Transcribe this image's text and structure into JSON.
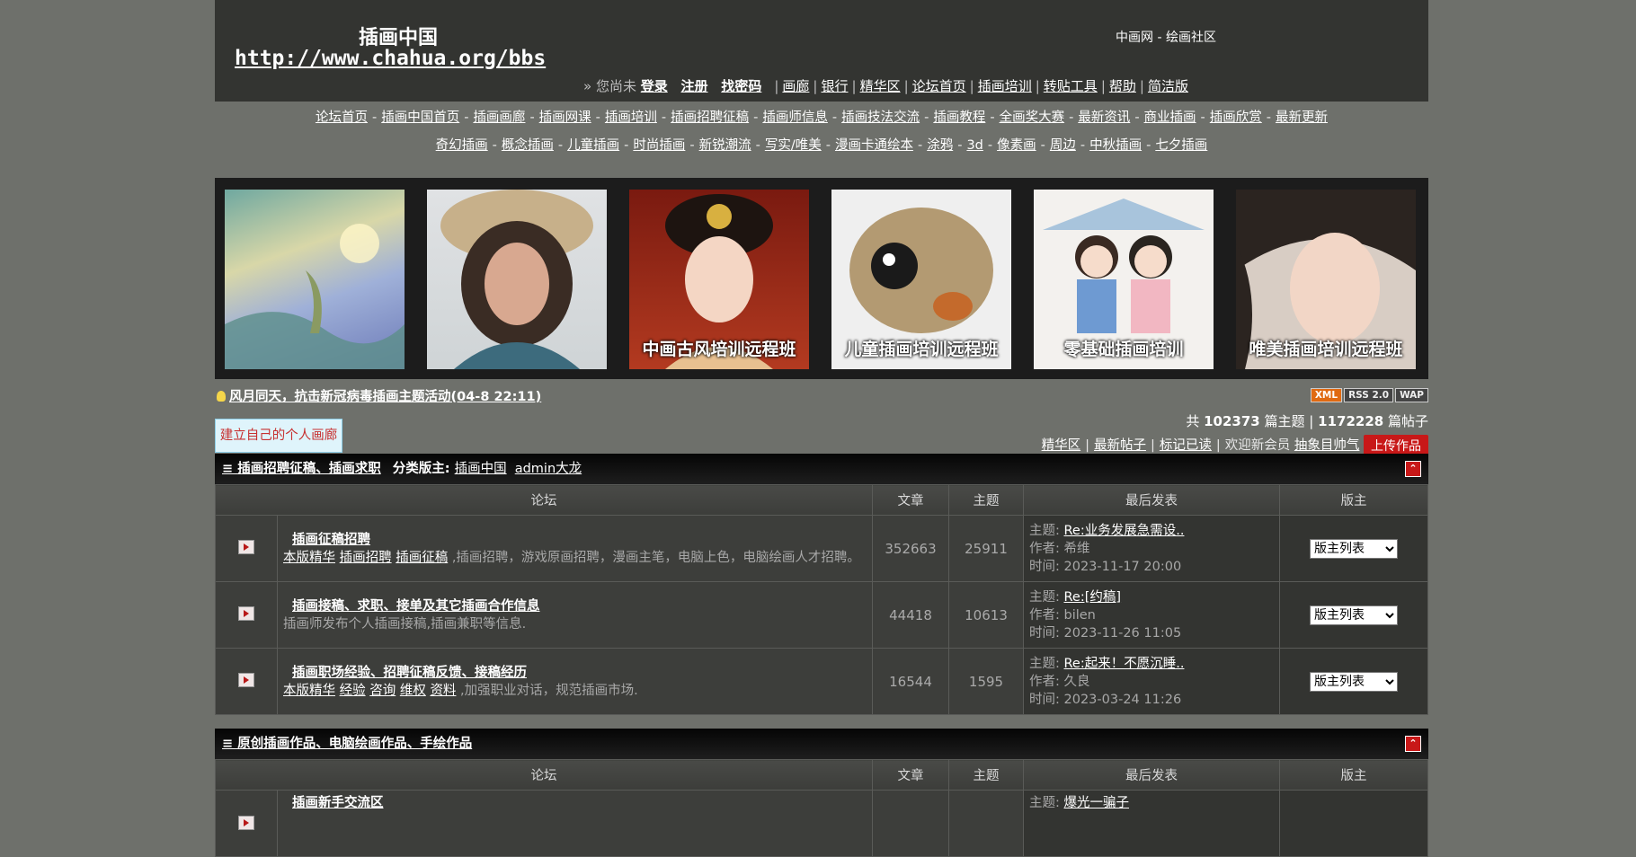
{
  "header": {
    "site_name": "插画中国",
    "site_url": "http://www.chahua.org/bbs",
    "community": "中画网 - 绘画社区",
    "nav_prefix": "» 您尚未",
    "login": "登录",
    "register": "注册",
    "find_password": "找密码",
    "nav": [
      "画廊",
      "银行",
      "精华区",
      "论坛首页",
      "插画培训",
      "转贴工具",
      "帮助",
      "简洁版"
    ]
  },
  "categories": {
    "row1": [
      "论坛首页",
      "插画中国首页",
      "插画画廊",
      "插画网课",
      "插画培训",
      "插画招聘征稿",
      "插画师信息",
      "插画技法交流",
      "插画教程",
      "全画奖大赛",
      "最新资讯",
      "商业插画",
      "插画欣赏",
      "最新更新"
    ],
    "row2": [
      "奇幻插画",
      "概念插画",
      "儿童插画",
      "时尚插画",
      "新锐潮流",
      "写实/唯美",
      "漫画卡通绘本",
      "涂鸦",
      "3d",
      "像素画",
      "周边",
      "中秋插画",
      "七夕插画"
    ]
  },
  "banner": {
    "captions": [
      "",
      "",
      "中画古风培训远程班",
      "儿童插画培训远程班",
      "零基础插画培训",
      "唯美插画培训远程班"
    ]
  },
  "notice": {
    "text": "风月同天，抗击新冠病毒插画主题活动(04-8 22:11)",
    "badges": [
      "XML",
      "RSS 2.0",
      "WAP"
    ]
  },
  "gallery_button": "建立自己的个人画廊",
  "stats": {
    "prefix": "共",
    "topics": "102373",
    "topics_label": "篇主题 |",
    "posts": "1172228",
    "posts_label": "篇帖子"
  },
  "subnav": {
    "links": [
      "精华区",
      "最新帖子",
      "标记已读"
    ],
    "welcome": "欢迎新会员",
    "new_member": "抽象目帅气",
    "upload": "上传作品"
  },
  "sections": [
    {
      "title": "≡ 插画招聘征稿、插画求职",
      "mods_label": "分类版主:",
      "mods": [
        "插画中国",
        "admin大龙"
      ],
      "columns": [
        "论坛",
        "文章",
        "主题",
        "最后发表",
        "版主"
      ],
      "forums": [
        {
          "title": "插画征稿招聘",
          "links": [
            "本版精华",
            "插画招聘",
            "插画征稿"
          ],
          "desc": ",插画招聘，游戏原画招聘，漫画主笔，电脑上色，电脑绘画人才招聘。",
          "posts": "352663",
          "topics": "25911",
          "last_topic": "Re:业务发展急需设..",
          "last_author": "希维",
          "last_time": "2023-11-17 20:00",
          "mods_select": "版主列表"
        },
        {
          "title": "插画接稿、求职、接单及其它插画合作信息",
          "links": [],
          "desc": "插画师发布个人插画接稿,插画兼职等信息.",
          "posts": "44418",
          "topics": "10613",
          "last_topic": "Re:[约稿]",
          "last_author": "bilen",
          "last_time": "2023-11-26 11:05",
          "mods_select": "版主列表"
        },
        {
          "title": "插画职场经验、招聘征稿反馈、接稿经历",
          "links": [
            "本版精华",
            "经验",
            "咨询",
            "维权",
            "资料"
          ],
          "desc": ",加强职业对话，规范插画市场.",
          "posts": "16544",
          "topics": "1595",
          "last_topic": "Re:起来！不愿沉睡..",
          "last_author": "久良",
          "last_time": "2023-03-24 11:26",
          "mods_select": "版主列表"
        }
      ]
    },
    {
      "title": "≡ 原创插画作品、电脑绘画作品、手绘作品",
      "columns": [
        "论坛",
        "文章",
        "主题",
        "最后发表",
        "版主"
      ],
      "forums": [
        {
          "title": "插画新手交流区",
          "last_topic": "爆光一骗子"
        }
      ]
    }
  ],
  "labels": {
    "topic": "主题:",
    "author": "作者:",
    "time": "时间:"
  }
}
